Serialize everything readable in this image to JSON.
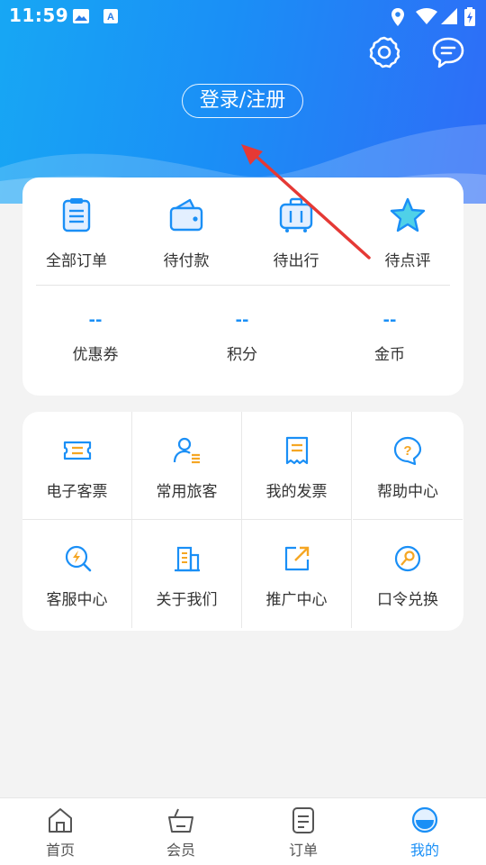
{
  "status_bar": {
    "time": "11:59"
  },
  "header": {
    "login_label": "登录/注册"
  },
  "orders": [
    {
      "label": "全部订单"
    },
    {
      "label": "待付款"
    },
    {
      "label": "待出行"
    },
    {
      "label": "待点评"
    }
  ],
  "stats": [
    {
      "value": "--",
      "label": "优惠券"
    },
    {
      "value": "--",
      "label": "积分"
    },
    {
      "value": "--",
      "label": "金币"
    }
  ],
  "services": [
    {
      "label": "电子客票"
    },
    {
      "label": "常用旅客"
    },
    {
      "label": "我的发票"
    },
    {
      "label": "帮助中心"
    },
    {
      "label": "客服中心"
    },
    {
      "label": "关于我们"
    },
    {
      "label": "推广中心"
    },
    {
      "label": "口令兑换"
    }
  ],
  "tabs": [
    {
      "label": "首页"
    },
    {
      "label": "会员"
    },
    {
      "label": "订单"
    },
    {
      "label": "我的"
    }
  ],
  "colors": {
    "accent": "#1a8ff6",
    "orange": "#f5a623",
    "arrow": "#e53935"
  }
}
